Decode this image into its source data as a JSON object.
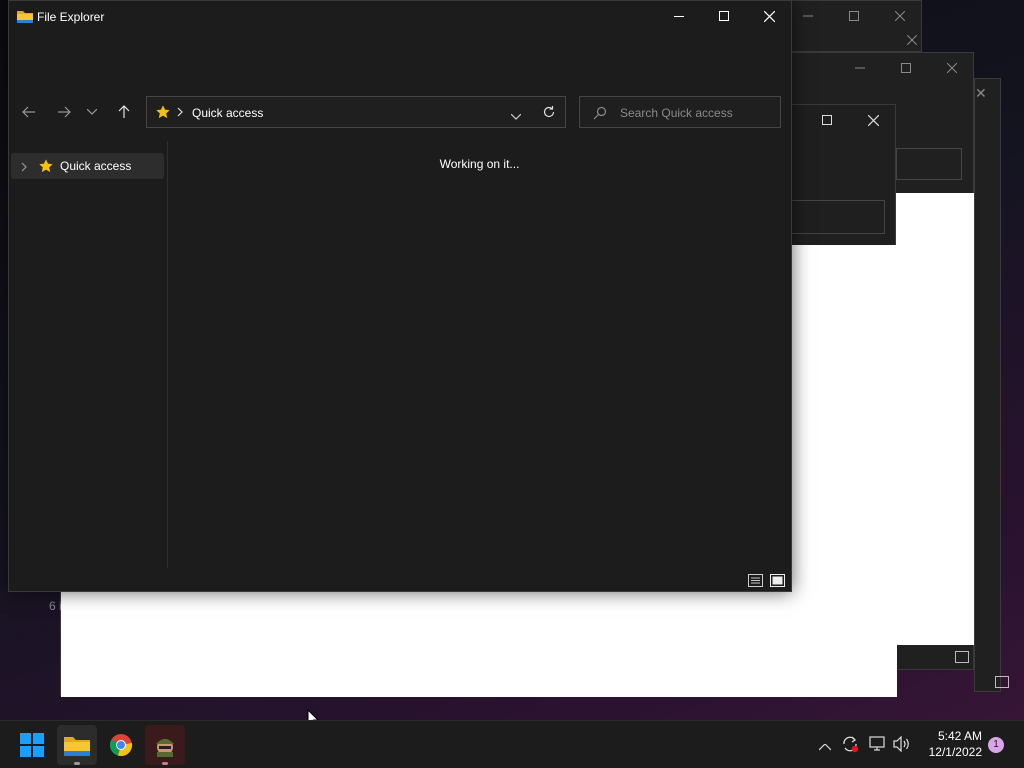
{
  "window": {
    "title": "File Explorer",
    "minimize_label": "Minimize",
    "maximize_label": "Maximize",
    "close_label": "Close"
  },
  "address_bar": {
    "location": "Quick access"
  },
  "search": {
    "placeholder": "Search Quick access"
  },
  "nav_pane": {
    "items": [
      {
        "label": "Quick access"
      }
    ]
  },
  "content": {
    "status": "Working on it..."
  },
  "behind_window": {
    "status_partial": "6 i"
  },
  "taskbar": {
    "apps": [
      "start-icon",
      "file-explorer-icon",
      "chrome-icon",
      "soldier-app-icon"
    ],
    "time": "5:42 AM",
    "date": "12/1/2022",
    "notification_count": "1"
  },
  "colors": {
    "window_bg": "#1c1c1c",
    "accent_blue": "#0078d4",
    "star_yellow": "#f4c20d",
    "folder_yellow": "#f8c537",
    "notification_badge": "#d7a5e8",
    "network_alert": "#e81123"
  }
}
